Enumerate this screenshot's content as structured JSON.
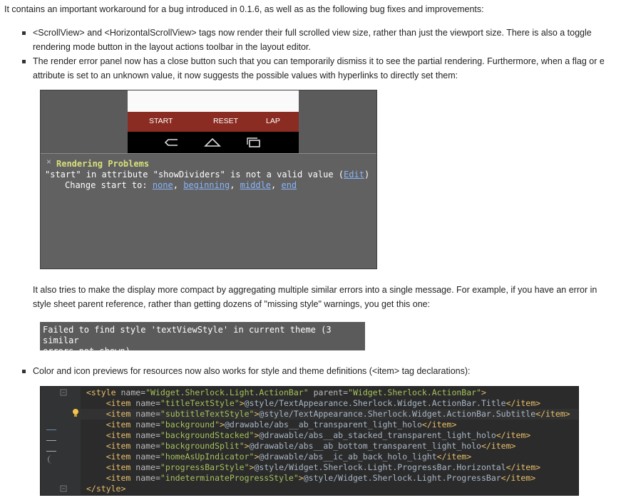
{
  "intro": "It contains an important workaround for a bug introduced in 0.1.6, as well as as the following bug fixes and improvements:",
  "bullets": {
    "b1_l1": "<ScrollView> and <HorizontalScrollView> tags now render their full scrolled view size, rather than just the viewport size. There is also a toggle",
    "b1_l2": "rendering mode button in the layout actions toolbar in the layout editor.",
    "b2_l1": "The render error panel now has a close button such that you can temporarily dismiss it to see the partial rendering. Furthermore, when a flag or e",
    "b2_l2": "attribute is set to an unknown value, it now suggests the possible values with hyperlinks to directly set them:",
    "b3": "Color and icon previews for resources now also works for style and theme definitions (<item> tag declarations):"
  },
  "render_panel": {
    "actions": [
      "START",
      "RESET",
      "LAP"
    ],
    "close_glyph": "×",
    "title": "Rendering Problems",
    "message": "\"start\" in attribute \"showDividers\" is not a valid value (",
    "edit_link": "Edit",
    "message_end": ")",
    "change_prefix": "Change start to: ",
    "options": [
      "none",
      "beginning",
      "middle",
      "end"
    ]
  },
  "compact_text_l1": "It also tries to make the display more compact by aggregating multiple similar errors into a single message. For example, if you have an error in",
  "compact_text_l2": "style sheet parent reference, rather than getting dozens of \"missing style\" warnings, you get this one:",
  "error_box": {
    "line1": "Failed to find style 'textViewStyle' in current theme (3 similar",
    "line2": "errors not shown)"
  },
  "code": {
    "style_name": "Widget.Sherlock.Light.ActionBar",
    "style_parent": "Widget.Sherlock.ActionBar",
    "items": [
      {
        "name": "titleTextStyle",
        "value": "@style/TextAppearance.Sherlock.Widget.ActionBar.Title"
      },
      {
        "name": "subtitleTextStyle",
        "value": "@style/TextAppearance.Sherlock.Widget.ActionBar.Subtitle"
      },
      {
        "name": "background",
        "value": "@drawable/abs__ab_transparent_light_holo"
      },
      {
        "name": "backgroundStacked",
        "value": "@drawable/abs__ab_stacked_transparent_light_holo"
      },
      {
        "name": "backgroundSplit",
        "value": "@drawable/abs__ab_bottom_transparent_light_holo"
      },
      {
        "name": "homeAsUpIndicator",
        "value": "@drawable/abs__ic_ab_back_holo_light"
      },
      {
        "name": "progressBarStyle",
        "value": "@style/Widget.Sherlock.Light.ProgressBar.Horizontal"
      },
      {
        "name": "indeterminateProgressStyle",
        "value": "@style/Widget.Sherlock.Light.ProgressBar"
      }
    ]
  },
  "colors": {
    "actionbar": "#8b2c22",
    "panel": "#5b5b5b",
    "link": "#8ab4f8",
    "code_bg": "#2b2b2b",
    "tag": "#e8bf6a",
    "attr_value": "#a5c25c"
  }
}
